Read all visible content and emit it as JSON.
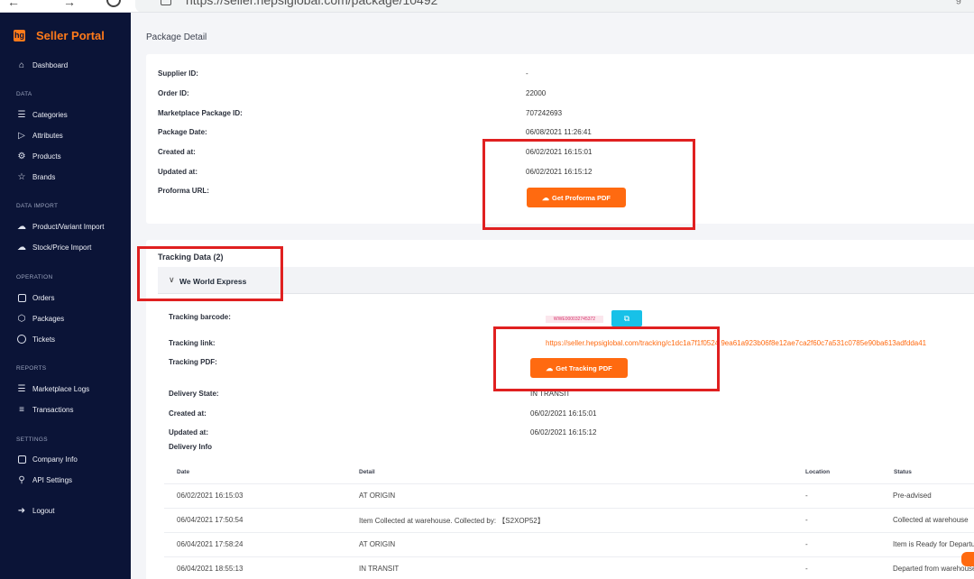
{
  "browser": {
    "url": "https://seller.hepsiglobal.com/package/10492",
    "url_right": "g"
  },
  "sidebar": {
    "brand_logo": "hg",
    "brand_title": "Seller Portal",
    "dashboard": "Dashboard",
    "sections": {
      "data": "DATA",
      "data_import": "DATA IMPORT",
      "operation": "OPERATION",
      "reports": "REPORTS",
      "settings": "SETTINGS"
    },
    "items": {
      "categories": "Categories",
      "attributes": "Attributes",
      "products": "Products",
      "brands": "Brands",
      "product_import": "Product/Variant Import",
      "stock_import": "Stock/Price Import",
      "orders": "Orders",
      "packages": "Packages",
      "tickets": "Tickets",
      "marketplace_logs": "Marketplace Logs",
      "transactions": "Transactions",
      "company_info": "Company Info",
      "api_settings": "API Settings",
      "logout": "Logout"
    }
  },
  "page": {
    "title": "Package Detail"
  },
  "package": {
    "labels": {
      "supplier_id": "Supplier ID:",
      "order_id": "Order ID:",
      "marketplace_package_id": "Marketplace Package ID:",
      "package_date": "Package Date:",
      "created_at": "Created at:",
      "updated_at": "Updated at:",
      "proforma_url": "Proforma URL:"
    },
    "values": {
      "supplier_id": "-",
      "order_id": "22000",
      "marketplace_package_id": "707242693",
      "package_date": "06/08/2021 11:26:41",
      "created_at": "06/02/2021 16:15:01",
      "updated_at": "06/02/2021 16:15:12"
    },
    "proforma_button": "Get Proforma PDF"
  },
  "tracking": {
    "title": "Tracking Data (2)",
    "carrier": "We World Express",
    "labels": {
      "barcode": "Tracking barcode:",
      "link": "Tracking link:",
      "pdf": "Tracking PDF:",
      "delivery_state": "Delivery State:",
      "created_at": "Created at:",
      "updated_at": "Updated at:",
      "delivery_info": "Delivery Info"
    },
    "barcode_value": "WWE000032745372",
    "link_value": "https://seller.hepsiglobal.com/tracking/c1dc1a7f1f0524 9ea61a923b06f8e12ae7ca2f60c7a531c0785e90ba613adfdda41",
    "pdf_button": "Get Tracking PDF",
    "delivery_state": "IN TRANSIT",
    "created_at": "06/02/2021 16:15:01",
    "updated_at": "06/02/2021 16:15:12",
    "table": {
      "headers": [
        "Date",
        "Detail",
        "Location",
        "Status"
      ],
      "rows": [
        [
          "06/02/2021 16:15:03",
          "AT ORIGIN",
          "-",
          "Pre-advised"
        ],
        [
          "06/04/2021 17:50:54",
          "Item Collected at warehouse. Collected by: 【S2XOP52】",
          "-",
          "Collected at warehouse"
        ],
        [
          "06/04/2021 17:58:24",
          "AT ORIGIN",
          "-",
          "Item is Ready for Departure"
        ],
        [
          "06/04/2021 18:55:13",
          "IN TRANSIT",
          "-",
          "Departed from warehouse"
        ]
      ]
    }
  },
  "colors": {
    "sidebar_bg": "#0b1437",
    "brand": "#ff7a1a",
    "primary_button": "#ff6a10",
    "copy_button": "#17c1e8",
    "annotation": "#e02020"
  }
}
